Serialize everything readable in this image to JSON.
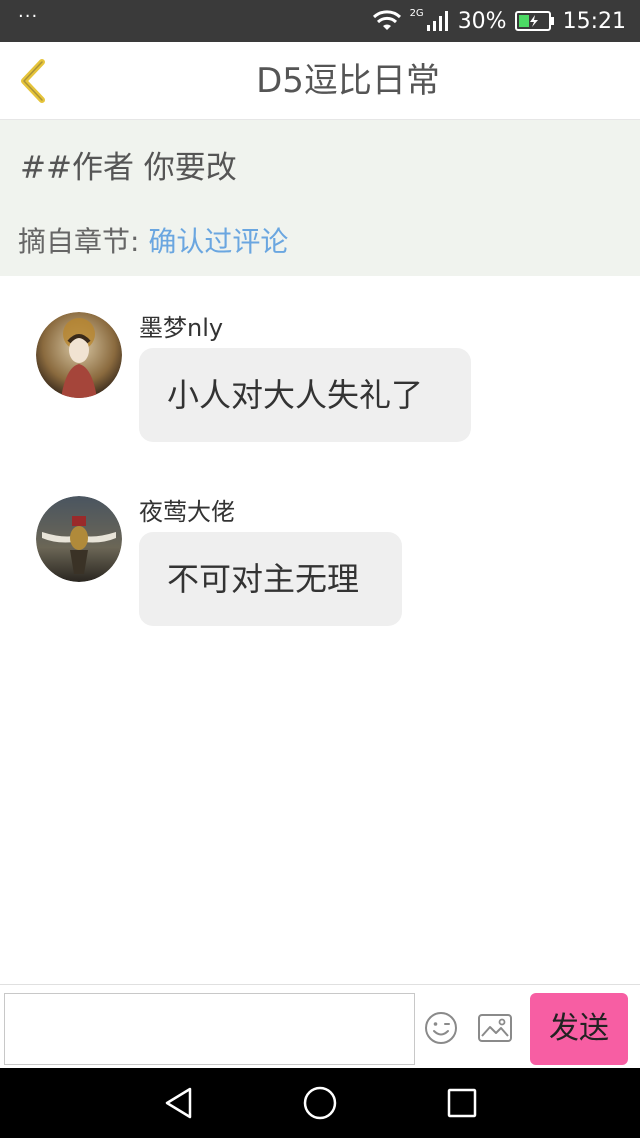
{
  "status_bar": {
    "dots": "···",
    "network_type": "2G",
    "battery_percent": "30%",
    "time": "15:21"
  },
  "header": {
    "title": "D5逗比日常"
  },
  "quote": {
    "text": "##作者 你要改",
    "chapter_label": "摘自章节:",
    "chapter_link": "确认过评论"
  },
  "messages": [
    {
      "sender": "墨梦nly",
      "text": "小人对大人失礼了"
    },
    {
      "sender": "夜莺大佬",
      "text": "不可对主无理"
    }
  ],
  "input": {
    "placeholder": "",
    "send_label": "发送"
  },
  "colors": {
    "accent_send": "#f75ea3",
    "link": "#6aa6e0",
    "back_arrow": "#e6c43a",
    "quote_bg": "#f0f3ee",
    "bubble_bg": "#efefef"
  },
  "icons": {
    "back": "chevron-left-icon",
    "emoji": "smiley-icon",
    "image": "image-icon",
    "nav_back": "triangle-back-icon",
    "nav_home": "circle-home-icon",
    "nav_recent": "square-recent-icon"
  }
}
